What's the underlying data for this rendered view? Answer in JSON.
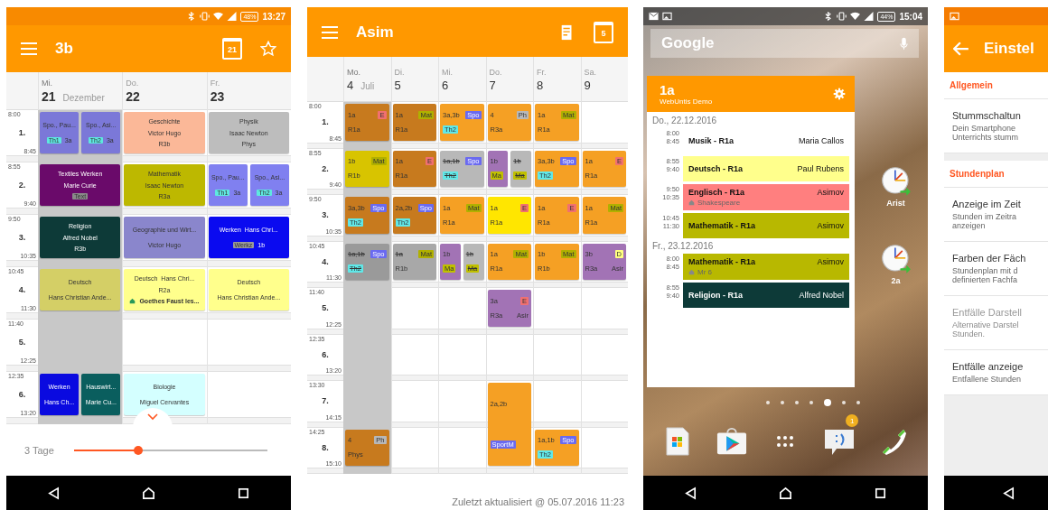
{
  "screen_class": {
    "status_bar": {
      "battery": "48%",
      "time": "13:27"
    },
    "toolbar": {
      "title": "3b",
      "calendar_day": "21"
    },
    "days": [
      {
        "weekday": "Mi.",
        "date": "21",
        "month": "Dezember",
        "selected": true
      },
      {
        "weekday": "Do.",
        "date": "22",
        "selected": false
      },
      {
        "weekday": "Fr.",
        "date": "23",
        "selected": false
      }
    ],
    "periods": [
      {
        "start": "8:00",
        "number": "1.",
        "end": "8:45",
        "cells": [
          [
            {
              "color": "#7b78d8",
              "lines": [
                [
                  {
                    "text": "Spo., Pau..."
                  }
                ],
                [
                  {
                    "text": "Th1",
                    "color": "#5ee8e0"
                  },
                  {
                    "text": "3a"
                  }
                ]
              ]
            },
            {
              "color": "#7b78d8",
              "lines": [
                [
                  {
                    "text": "Spo., Asi..."
                  }
                ],
                [
                  {
                    "text": "Th2",
                    "color": "#5ee8e0"
                  },
                  {
                    "text": "3a"
                  }
                ]
              ]
            }
          ],
          [
            {
              "color": "#fbb898",
              "lines": [
                [
                  {
                    "text": "Geschichte"
                  }
                ],
                [
                  {
                    "text": "Victor Hugo"
                  }
                ],
                [
                  {
                    "text": "R3b"
                  }
                ]
              ]
            }
          ],
          [
            {
              "color": "#bdbdbd",
              "lines": [
                [
                  {
                    "text": "Physik"
                  }
                ],
                [
                  {
                    "text": "Isaac Newton"
                  }
                ],
                [
                  {
                    "text": "Phys"
                  }
                ]
              ]
            }
          ]
        ]
      },
      {
        "start": "8:55",
        "number": "2.",
        "end": "9:40",
        "cells": [
          [
            {
              "color": "#6a0a6a",
              "lines": [
                [
                  {
                    "text": "Textiles Werken"
                  }
                ],
                [
                  {
                    "text": "Marie Curie"
                  }
                ],
                [
                  {
                    "text": "Text",
                    "color": "#8a8a8a"
                  }
                ]
              ]
            }
          ],
          [
            {
              "color": "#bdb800",
              "lines": [
                [
                  {
                    "text": "Mathematik"
                  }
                ],
                [
                  {
                    "text": "Isaac Newton"
                  }
                ],
                [
                  {
                    "text": "R3a"
                  }
                ]
              ]
            }
          ],
          [
            {
              "color": "#8080f0",
              "lines": [
                [
                  {
                    "text": "Spo., Pau..."
                  }
                ],
                [
                  {
                    "text": "Th1",
                    "color": "#5ee8e0"
                  },
                  {
                    "text": "3a"
                  }
                ]
              ]
            },
            {
              "color": "#8080f0",
              "lines": [
                [
                  {
                    "text": "Spo., Asi..."
                  }
                ],
                [
                  {
                    "text": "Th2",
                    "color": "#5ee8e0"
                  },
                  {
                    "text": "3a"
                  }
                ]
              ]
            }
          ]
        ]
      },
      {
        "start": "9:50",
        "number": "3.",
        "end": "10:35",
        "cells": [
          [
            {
              "color": "#0d3a38",
              "lines": [
                [
                  {
                    "text": "Religion"
                  }
                ],
                [
                  {
                    "text": "Alfred Nobel"
                  }
                ],
                [
                  {
                    "text": "R3b"
                  }
                ]
              ]
            }
          ],
          [
            {
              "color": "#8a86cc",
              "lines": [
                [
                  {
                    "text": "Geographie und Wirt..."
                  }
                ],
                [
                  {
                    "text": "Victor Hugo"
                  }
                ]
              ]
            }
          ],
          [
            {
              "color": "#0a0af0",
              "lines": [
                [
                  {
                    "text": "Werken"
                  },
                  {
                    "text": "Hans Chri..."
                  }
                ],
                [
                  {
                    "text": "Werkz",
                    "color": "#9a9a9a"
                  },
                  {
                    "text": "1b"
                  }
                ]
              ]
            }
          ]
        ]
      },
      {
        "start": "10:45",
        "number": "4.",
        "end": "11:30",
        "cells": [
          [
            {
              "color": "#d4cf66",
              "lines": [
                [
                  {
                    "text": "Deutsch"
                  }
                ],
                [
                  {
                    "text": "Hans Christian Ande..."
                  }
                ]
              ]
            }
          ],
          [
            {
              "color": "#ffff8c",
              "lines": [
                [
                  {
                    "text": "Deutsch"
                  },
                  {
                    "text": "Hans Chri..."
                  }
                ],
                [
                  {
                    "text": "R2a"
                  }
                ]
              ],
              "note": "Goethes Faust les..."
            }
          ],
          [
            {
              "color": "#ffff8c",
              "lines": [
                [
                  {
                    "text": "Deutsch"
                  }
                ],
                [
                  {
                    "text": "Hans Christian Ande..."
                  }
                ]
              ]
            }
          ]
        ]
      },
      {
        "start": "11:40",
        "number": "5.",
        "end": "12:25",
        "cells": [
          [],
          [],
          []
        ]
      },
      {
        "start": "12:35",
        "number": "6.",
        "end": "13:20",
        "cells": [
          [
            {
              "color": "#0a0ae0",
              "lines": [
                [
                  {
                    "text": "Werken"
                  }
                ],
                [
                  {
                    "text": "Hans Ch..."
                  }
                ]
              ]
            },
            {
              "color": "#0a5e5e",
              "lines": [
                [
                  {
                    "text": "Hauswirt..."
                  }
                ],
                [
                  {
                    "text": "Marie Cu..."
                  }
                ]
              ]
            }
          ],
          [
            {
              "color": "#d4ffff",
              "lines": [
                [
                  {
                    "text": "Biologie"
                  }
                ],
                [
                  {
                    "text": "Miguel Cervantes"
                  }
                ]
              ]
            }
          ],
          []
        ]
      }
    ],
    "day_range": {
      "label": "3 Tage",
      "level": 0.33
    }
  },
  "screen_teacher": {
    "toolbar": {
      "title": "Asim",
      "calendar_day": "5"
    },
    "days": [
      {
        "weekday": "Mo.",
        "date": "4",
        "month": "Juli",
        "selected": true
      },
      {
        "weekday": "Di.",
        "date": "5",
        "selected": false
      },
      {
        "weekday": "Mi.",
        "date": "6",
        "selected": false
      },
      {
        "weekday": "Do.",
        "date": "7",
        "selected": false
      },
      {
        "weekday": "Fr.",
        "date": "8",
        "selected": false
      },
      {
        "weekday": "Sa.",
        "date": "9",
        "selected": false
      }
    ],
    "periods": [
      {
        "start": "8:00",
        "number": "1.",
        "end": "8:45",
        "cells": [
          [
            {
              "color": "#c77a1e",
              "cancelled": false,
              "lines": [
                [
                  {
                    "text": "1a"
                  },
                  {
                    "text": "E",
                    "color": "#f07070"
                  }
                ],
                [
                  {
                    "text": "R1a"
                  }
                ]
              ]
            }
          ],
          [
            {
              "color": "#c77a1e",
              "cancelled": false,
              "lines": [
                [
                  {
                    "text": "1a"
                  },
                  {
                    "text": "Mat",
                    "color": "#b0b000"
                  }
                ],
                [
                  {
                    "text": "R1a"
                  }
                ]
              ]
            }
          ],
          [
            {
              "color": "#f5a024",
              "cancelled": false,
              "lines": [
                [
                  {
                    "text": "3a,3b"
                  },
                  {
                    "text": "Spo",
                    "color": "#6a6af0"
                  }
                ],
                [
                  {
                    "text": "Th2",
                    "color": "#60e8e8"
                  }
                ]
              ]
            }
          ],
          [
            {
              "color": "#f5a024",
              "cancelled": false,
              "lines": [
                [
                  {
                    "text": "4"
                  },
                  {
                    "text": "Ph",
                    "color": "#b8b8b8"
                  }
                ],
                [
                  {
                    "text": "R3a"
                  }
                ]
              ]
            }
          ],
          [
            {
              "color": "#f5a024",
              "cancelled": false,
              "lines": [
                [
                  {
                    "text": "1a"
                  },
                  {
                    "text": "Mat",
                    "color": "#b0b000"
                  }
                ],
                [
                  {
                    "text": "R1a"
                  }
                ]
              ]
            }
          ],
          []
        ]
      },
      {
        "start": "8:55",
        "number": "2.",
        "end": "9:40",
        "cells": [
          [
            {
              "color": "#d8c400",
              "cancelled": false,
              "lines": [
                [
                  {
                    "text": "1b"
                  },
                  {
                    "text": "Mat",
                    "color": "#b0b000"
                  }
                ],
                [
                  {
                    "text": "R1b"
                  }
                ]
              ]
            }
          ],
          [
            {
              "color": "#c77a1e",
              "cancelled": false,
              "lines": [
                [
                  {
                    "text": "1a"
                  },
                  {
                    "text": "E",
                    "color": "#f07070"
                  }
                ],
                [
                  {
                    "text": "R1a"
                  }
                ]
              ]
            }
          ],
          [
            {
              "color": "#b8b8b8",
              "cancelled": true,
              "lines": [
                [
                  {
                    "text": "1a,1b"
                  },
                  {
                    "text": "Spo",
                    "color": "#6a6af0"
                  }
                ],
                [
                  {
                    "text": "Th2",
                    "color": "#60e8e8"
                  }
                ]
              ]
            }
          ],
          [
            {
              "color": "#a273b5",
              "cancelled": false,
              "lines": [
                [
                  {
                    "text": "1b"
                  }
                ],
                [
                  {
                    "text": "Ma",
                    "color": "#c0c000"
                  }
                ]
              ]
            },
            {
              "color": "#b8b8b8",
              "cancelled": true,
              "lines": [
                [
                  {
                    "text": "1b"
                  }
                ],
                [
                  {
                    "text": "Ma",
                    "color": "#c0c000"
                  }
                ]
              ]
            }
          ],
          [
            {
              "color": "#f5a024",
              "cancelled": false,
              "lines": [
                [
                  {
                    "text": "3a,3b"
                  },
                  {
                    "text": "Spo",
                    "color": "#6a6af0"
                  }
                ],
                [
                  {
                    "text": "Th2",
                    "color": "#60e8e8"
                  }
                ]
              ]
            }
          ],
          [
            {
              "color": "#f5a024",
              "cancelled": false,
              "lines": [
                [
                  {
                    "text": "1a"
                  },
                  {
                    "text": "E",
                    "color": "#f07070"
                  }
                ],
                [
                  {
                    "text": "R1a"
                  }
                ]
              ]
            }
          ]
        ]
      },
      {
        "start": "9:50",
        "number": "3.",
        "end": "10:35",
        "cells": [
          [
            {
              "color": "#c77a1e",
              "cancelled": false,
              "lines": [
                [
                  {
                    "text": "3a,3b"
                  },
                  {
                    "text": "Spo",
                    "color": "#6a6af0"
                  }
                ],
                [
                  {
                    "text": "Th2",
                    "color": "#60e8e8"
                  }
                ]
              ]
            }
          ],
          [
            {
              "color": "#c77a1e",
              "cancelled": false,
              "lines": [
                [
                  {
                    "text": "2a,2b"
                  },
                  {
                    "text": "Spo",
                    "color": "#6a6af0"
                  }
                ],
                [
                  {
                    "text": "Th2",
                    "color": "#60e8e8"
                  }
                ]
              ]
            }
          ],
          [
            {
              "color": "#f5a024",
              "cancelled": false,
              "lines": [
                [
                  {
                    "text": "1a"
                  },
                  {
                    "text": "Mat",
                    "color": "#b0b000"
                  }
                ],
                [
                  {
                    "text": "R1a"
                  }
                ]
              ]
            }
          ],
          [
            {
              "color": "#ffe600",
              "cancelled": false,
              "lines": [
                [
                  {
                    "text": "1a"
                  },
                  {
                    "text": "E",
                    "color": "#f07070"
                  }
                ],
                [
                  {
                    "text": "R1a"
                  }
                ]
              ]
            }
          ],
          [
            {
              "color": "#f5a024",
              "cancelled": false,
              "lines": [
                [
                  {
                    "text": "1a"
                  },
                  {
                    "text": "E",
                    "color": "#f07070"
                  }
                ],
                [
                  {
                    "text": "R1a"
                  }
                ]
              ]
            }
          ],
          [
            {
              "color": "#f5a024",
              "cancelled": false,
              "lines": [
                [
                  {
                    "text": "1a"
                  },
                  {
                    "text": "Mat",
                    "color": "#b0b000"
                  }
                ],
                [
                  {
                    "text": "R1a"
                  }
                ]
              ]
            }
          ]
        ]
      },
      {
        "start": "10:45",
        "number": "4.",
        "end": "11:30",
        "cells": [
          [
            {
              "color": "#9a9a9a",
              "cancelled": true,
              "lines": [
                [
                  {
                    "text": "1a,1b"
                  },
                  {
                    "text": "Spo",
                    "color": "#6a6af0"
                  }
                ],
                [
                  {
                    "text": "Th2",
                    "color": "#60e8e8"
                  }
                ]
              ]
            }
          ],
          [
            {
              "color": "#a8a8a8",
              "cancelled": true,
              "lines": [
                [
                  {
                    "text": "1a"
                  },
                  {
                    "text": "Mat",
                    "color": "#b0b000"
                  }
                ],
                [
                  {
                    "text": "R1b"
                  }
                ]
              ]
            }
          ],
          [
            {
              "color": "#a273b5",
              "cancelled": false,
              "lines": [
                [
                  {
                    "text": "1b"
                  }
                ],
                [
                  {
                    "text": "Ma",
                    "color": "#c0c000"
                  }
                ]
              ]
            },
            {
              "color": "#b8b8b8",
              "cancelled": true,
              "lines": [
                [
                  {
                    "text": "1b"
                  }
                ],
                [
                  {
                    "text": "Ma",
                    "color": "#c0c000"
                  }
                ]
              ]
            }
          ],
          [
            {
              "color": "#f5a024",
              "cancelled": false,
              "lines": [
                [
                  {
                    "text": "1a"
                  },
                  {
                    "text": "Mat",
                    "color": "#b0b000"
                  }
                ],
                [
                  {
                    "text": "R1a"
                  }
                ]
              ]
            }
          ],
          [
            {
              "color": "#f5a024",
              "cancelled": false,
              "lines": [
                [
                  {
                    "text": "1b"
                  },
                  {
                    "text": "Mat",
                    "color": "#b0b000"
                  }
                ],
                [
                  {
                    "text": "R1b"
                  }
                ]
              ]
            }
          ],
          [
            {
              "color": "#a273b5",
              "cancelled": false,
              "lines": [
                [
                  {
                    "text": "3b"
                  },
                  {
                    "text": "D",
                    "color": "#ffff80"
                  }
                ],
                [
                  {
                    "text": "R3a"
                  },
                  {
                    "text": "Asir"
                  }
                ]
              ]
            }
          ]
        ]
      },
      {
        "start": "11:40",
        "number": "5.",
        "end": "12:25",
        "cells": [
          [],
          [],
          [],
          [
            {
              "color": "#a273b5",
              "cancelled": false,
              "lines": [
                [
                  {
                    "text": "3a"
                  },
                  {
                    "text": "E",
                    "color": "#f07070"
                  }
                ],
                [
                  {
                    "text": "R3a"
                  },
                  {
                    "text": "Asir"
                  }
                ]
              ]
            }
          ],
          [],
          []
        ]
      },
      {
        "start": "12:35",
        "number": "6.",
        "end": "13:20",
        "cells": [
          [],
          [],
          [],
          [],
          [],
          []
        ]
      },
      {
        "start": "13:30",
        "number": "7.",
        "end": "14:15",
        "cells": [
          [],
          [],
          [],
          [
            {
              "color": "#f5a024",
              "cancelled": false,
              "double": true,
              "lines": [
                [
                  {
                    "text": "2a,2b"
                  }
                ],
                [
                  {
                    "text": "SportM",
                    "color": "#6a6af0"
                  }
                ]
              ]
            }
          ],
          [],
          []
        ]
      },
      {
        "start": "14:25",
        "number": "8.",
        "end": "15:10",
        "cells": [
          [
            {
              "color": "#c77a1e",
              "cancelled": false,
              "lines": [
                [
                  {
                    "text": "4"
                  },
                  {
                    "text": "Ph",
                    "color": "#b8b8b8"
                  }
                ],
                [
                  {
                    "text": "Phys"
                  }
                ]
              ]
            }
          ],
          [],
          [],
          [],
          [
            {
              "color": "#f5a024",
              "cancelled": false,
              "lines": [
                [
                  {
                    "text": "1a,1b"
                  },
                  {
                    "text": "Spo",
                    "color": "#6a6af0"
                  }
                ],
                [
                  {
                    "text": "Th2",
                    "color": "#60e8e8"
                  }
                ]
              ]
            }
          ],
          []
        ]
      }
    ],
    "footer": "Zuletzt aktualisiert @ 05.07.2016 11:23"
  },
  "screen_home": {
    "status_bar": {
      "battery": "44%",
      "time": "15:04"
    },
    "search": {
      "label": "Google"
    },
    "widget": {
      "title": "1a",
      "subtitle": "WebUntis Demo",
      "days": [
        {
          "date": "Do., 22.12.2016",
          "lessons": [
            {
              "start": "8:00",
              "end": "8:45",
              "subject": "Musik - R1a",
              "teacher": "Maria Callos",
              "color": "#ffffff"
            },
            {
              "start": "8:55",
              "end": "9:40",
              "subject": "Deutsch - R1a",
              "teacher": "Paul Rubens",
              "color": "#ffff8c"
            },
            {
              "start": "9:50",
              "end": "10:35",
              "subject": "Englisch - R1a",
              "teacher": "Asimov",
              "color": "#ff7f7f",
              "note": "Shakespeare"
            },
            {
              "start": "10:45",
              "end": "11:30",
              "subject": "Mathematik - R1a",
              "teacher": "Asimov",
              "color": "#b8b800"
            }
          ]
        },
        {
          "date": "Fr., 23.12.2016",
          "lessons": [
            {
              "start": "8:00",
              "end": "8:45",
              "subject": "Mathematik - R1a",
              "teacher": "Asimov",
              "color": "#b8b800",
              "note": "Mr 6"
            },
            {
              "start": "8:55",
              "end": "9:40",
              "subject": "Religion - R1a",
              "teacher": "Alfred Nobel",
              "color": "#0d3a38"
            }
          ]
        }
      ]
    },
    "shortcuts": [
      {
        "label": "Arist"
      },
      {
        "label": "2a"
      }
    ],
    "pages": [
      {
        "selected": false
      },
      {
        "selected": false
      },
      {
        "selected": false
      },
      {
        "selected": false
      },
      {
        "selected": true
      },
      {
        "selected": false
      },
      {
        "selected": false
      }
    ],
    "dock": {
      "badge": "1"
    }
  },
  "screen_settings": {
    "title": "Einstel",
    "sections": [
      {
        "title": "Allgemein",
        "items": [
          {
            "title": "Stummschaltun",
            "summary": [
              "Dein Smartphone",
              "Unterrichts stumm"
            ],
            "disabled": false
          }
        ]
      },
      {
        "title": "Stundenplan",
        "items": [
          {
            "title": "Anzeige im Zeit",
            "summary": [
              "Stunden im Zeitra",
              "anzeigen"
            ],
            "disabled": false
          },
          {
            "title": "Farben der Fäch",
            "summary": [
              "Stundenplan mit d",
              "definierten Fachfa"
            ],
            "disabled": false
          },
          {
            "title": "Entfälle Darstell",
            "summary": [
              "Alternative Darstel",
              "Stunden."
            ],
            "disabled": true
          },
          {
            "title": "Entfälle anzeige",
            "summary": [
              "Entfallene Stunden"
            ],
            "disabled": false
          }
        ]
      }
    ]
  }
}
